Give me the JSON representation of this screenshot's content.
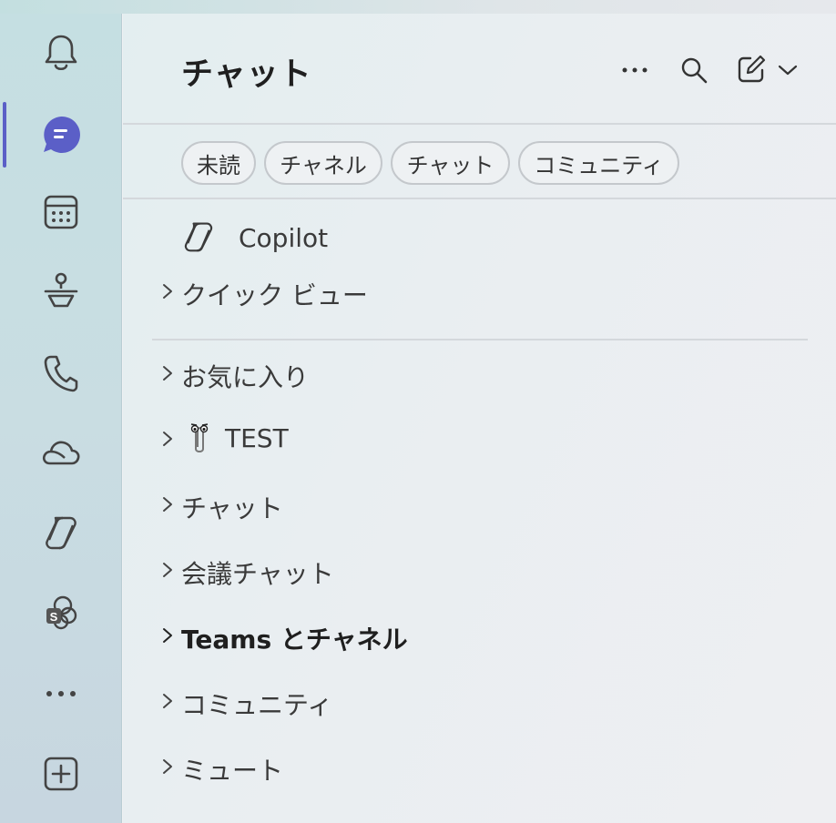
{
  "header": {
    "title": "チャット"
  },
  "filters": [
    "未読",
    "チャネル",
    "チャット",
    "コミュニティ"
  ],
  "copilot": {
    "label": "Copilot"
  },
  "sections": [
    {
      "label": "クイック ビュー"
    },
    {
      "label": "お気に入り"
    },
    {
      "label": "TEST"
    },
    {
      "label": "チャット"
    },
    {
      "label": "会議チャット"
    },
    {
      "label": "Teams とチャネル"
    },
    {
      "label": "コミュニティ"
    },
    {
      "label": "ミュート"
    }
  ],
  "rail": {
    "items": [
      "bell-icon",
      "chat-icon",
      "calendar-icon",
      "people-icon",
      "phone-icon",
      "onedrive-icon",
      "copilot-icon",
      "sharepoint-icon",
      "more-icon",
      "add-apps-icon"
    ]
  },
  "colors": {
    "accent": "#5b5fc7",
    "text": "#1f1f1f"
  }
}
